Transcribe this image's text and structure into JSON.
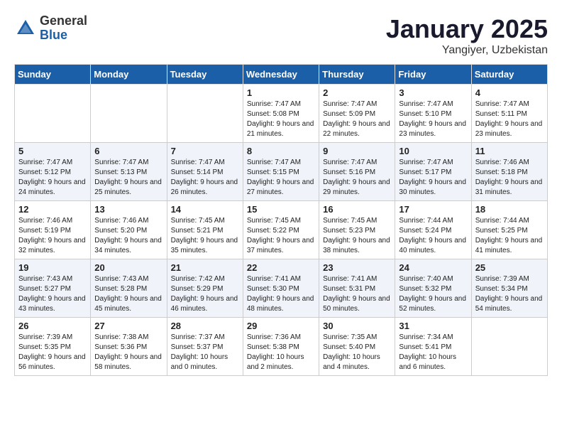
{
  "header": {
    "logo_line1": "General",
    "logo_line2": "Blue",
    "month": "January 2025",
    "location": "Yangiyer, Uzbekistan"
  },
  "weekdays": [
    "Sunday",
    "Monday",
    "Tuesday",
    "Wednesday",
    "Thursday",
    "Friday",
    "Saturday"
  ],
  "weeks": [
    [
      {
        "day": "",
        "sunrise": "",
        "sunset": "",
        "daylight": ""
      },
      {
        "day": "",
        "sunrise": "",
        "sunset": "",
        "daylight": ""
      },
      {
        "day": "",
        "sunrise": "",
        "sunset": "",
        "daylight": ""
      },
      {
        "day": "1",
        "sunrise": "Sunrise: 7:47 AM",
        "sunset": "Sunset: 5:08 PM",
        "daylight": "Daylight: 9 hours and 21 minutes."
      },
      {
        "day": "2",
        "sunrise": "Sunrise: 7:47 AM",
        "sunset": "Sunset: 5:09 PM",
        "daylight": "Daylight: 9 hours and 22 minutes."
      },
      {
        "day": "3",
        "sunrise": "Sunrise: 7:47 AM",
        "sunset": "Sunset: 5:10 PM",
        "daylight": "Daylight: 9 hours and 23 minutes."
      },
      {
        "day": "4",
        "sunrise": "Sunrise: 7:47 AM",
        "sunset": "Sunset: 5:11 PM",
        "daylight": "Daylight: 9 hours and 23 minutes."
      }
    ],
    [
      {
        "day": "5",
        "sunrise": "Sunrise: 7:47 AM",
        "sunset": "Sunset: 5:12 PM",
        "daylight": "Daylight: 9 hours and 24 minutes."
      },
      {
        "day": "6",
        "sunrise": "Sunrise: 7:47 AM",
        "sunset": "Sunset: 5:13 PM",
        "daylight": "Daylight: 9 hours and 25 minutes."
      },
      {
        "day": "7",
        "sunrise": "Sunrise: 7:47 AM",
        "sunset": "Sunset: 5:14 PM",
        "daylight": "Daylight: 9 hours and 26 minutes."
      },
      {
        "day": "8",
        "sunrise": "Sunrise: 7:47 AM",
        "sunset": "Sunset: 5:15 PM",
        "daylight": "Daylight: 9 hours and 27 minutes."
      },
      {
        "day": "9",
        "sunrise": "Sunrise: 7:47 AM",
        "sunset": "Sunset: 5:16 PM",
        "daylight": "Daylight: 9 hours and 29 minutes."
      },
      {
        "day": "10",
        "sunrise": "Sunrise: 7:47 AM",
        "sunset": "Sunset: 5:17 PM",
        "daylight": "Daylight: 9 hours and 30 minutes."
      },
      {
        "day": "11",
        "sunrise": "Sunrise: 7:46 AM",
        "sunset": "Sunset: 5:18 PM",
        "daylight": "Daylight: 9 hours and 31 minutes."
      }
    ],
    [
      {
        "day": "12",
        "sunrise": "Sunrise: 7:46 AM",
        "sunset": "Sunset: 5:19 PM",
        "daylight": "Daylight: 9 hours and 32 minutes."
      },
      {
        "day": "13",
        "sunrise": "Sunrise: 7:46 AM",
        "sunset": "Sunset: 5:20 PM",
        "daylight": "Daylight: 9 hours and 34 minutes."
      },
      {
        "day": "14",
        "sunrise": "Sunrise: 7:45 AM",
        "sunset": "Sunset: 5:21 PM",
        "daylight": "Daylight: 9 hours and 35 minutes."
      },
      {
        "day": "15",
        "sunrise": "Sunrise: 7:45 AM",
        "sunset": "Sunset: 5:22 PM",
        "daylight": "Daylight: 9 hours and 37 minutes."
      },
      {
        "day": "16",
        "sunrise": "Sunrise: 7:45 AM",
        "sunset": "Sunset: 5:23 PM",
        "daylight": "Daylight: 9 hours and 38 minutes."
      },
      {
        "day": "17",
        "sunrise": "Sunrise: 7:44 AM",
        "sunset": "Sunset: 5:24 PM",
        "daylight": "Daylight: 9 hours and 40 minutes."
      },
      {
        "day": "18",
        "sunrise": "Sunrise: 7:44 AM",
        "sunset": "Sunset: 5:25 PM",
        "daylight": "Daylight: 9 hours and 41 minutes."
      }
    ],
    [
      {
        "day": "19",
        "sunrise": "Sunrise: 7:43 AM",
        "sunset": "Sunset: 5:27 PM",
        "daylight": "Daylight: 9 hours and 43 minutes."
      },
      {
        "day": "20",
        "sunrise": "Sunrise: 7:43 AM",
        "sunset": "Sunset: 5:28 PM",
        "daylight": "Daylight: 9 hours and 45 minutes."
      },
      {
        "day": "21",
        "sunrise": "Sunrise: 7:42 AM",
        "sunset": "Sunset: 5:29 PM",
        "daylight": "Daylight: 9 hours and 46 minutes."
      },
      {
        "day": "22",
        "sunrise": "Sunrise: 7:41 AM",
        "sunset": "Sunset: 5:30 PM",
        "daylight": "Daylight: 9 hours and 48 minutes."
      },
      {
        "day": "23",
        "sunrise": "Sunrise: 7:41 AM",
        "sunset": "Sunset: 5:31 PM",
        "daylight": "Daylight: 9 hours and 50 minutes."
      },
      {
        "day": "24",
        "sunrise": "Sunrise: 7:40 AM",
        "sunset": "Sunset: 5:32 PM",
        "daylight": "Daylight: 9 hours and 52 minutes."
      },
      {
        "day": "25",
        "sunrise": "Sunrise: 7:39 AM",
        "sunset": "Sunset: 5:34 PM",
        "daylight": "Daylight: 9 hours and 54 minutes."
      }
    ],
    [
      {
        "day": "26",
        "sunrise": "Sunrise: 7:39 AM",
        "sunset": "Sunset: 5:35 PM",
        "daylight": "Daylight: 9 hours and 56 minutes."
      },
      {
        "day": "27",
        "sunrise": "Sunrise: 7:38 AM",
        "sunset": "Sunset: 5:36 PM",
        "daylight": "Daylight: 9 hours and 58 minutes."
      },
      {
        "day": "28",
        "sunrise": "Sunrise: 7:37 AM",
        "sunset": "Sunset: 5:37 PM",
        "daylight": "Daylight: 10 hours and 0 minutes."
      },
      {
        "day": "29",
        "sunrise": "Sunrise: 7:36 AM",
        "sunset": "Sunset: 5:38 PM",
        "daylight": "Daylight: 10 hours and 2 minutes."
      },
      {
        "day": "30",
        "sunrise": "Sunrise: 7:35 AM",
        "sunset": "Sunset: 5:40 PM",
        "daylight": "Daylight: 10 hours and 4 minutes."
      },
      {
        "day": "31",
        "sunrise": "Sunrise: 7:34 AM",
        "sunset": "Sunset: 5:41 PM",
        "daylight": "Daylight: 10 hours and 6 minutes."
      },
      {
        "day": "",
        "sunrise": "",
        "sunset": "",
        "daylight": ""
      }
    ]
  ]
}
